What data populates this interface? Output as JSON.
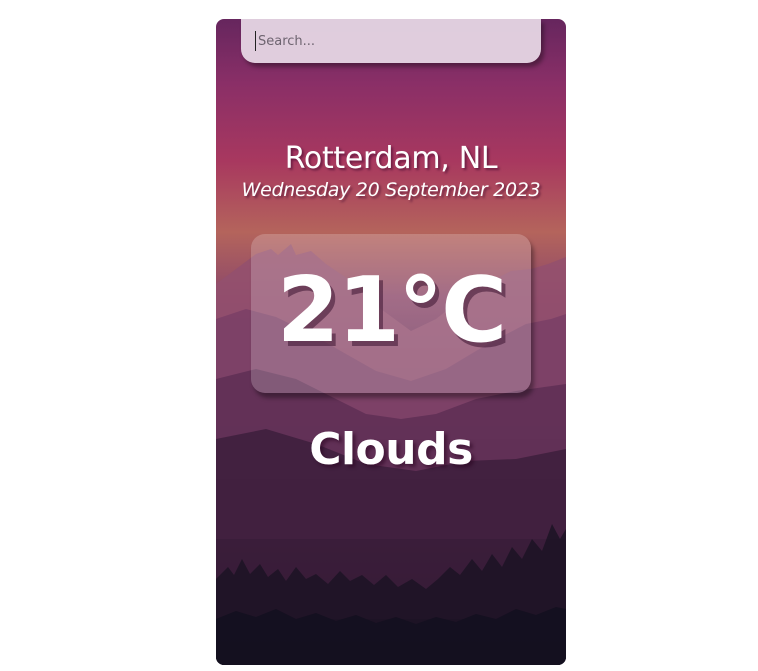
{
  "search": {
    "placeholder": "Search...",
    "value": ""
  },
  "weather": {
    "location": "Rotterdam, NL",
    "date": "Wednesday 20 September 2023",
    "temperature": "21°C",
    "condition": "Clouds"
  },
  "colors": {
    "gradient_top": "#66265e",
    "gradient_pink": "#a8385f",
    "gradient_bottom": "#120f1c",
    "search_bg": "#e6d6e4",
    "text": "#ffffff"
  },
  "background": {
    "icon": "mountain-forest-landscape"
  }
}
